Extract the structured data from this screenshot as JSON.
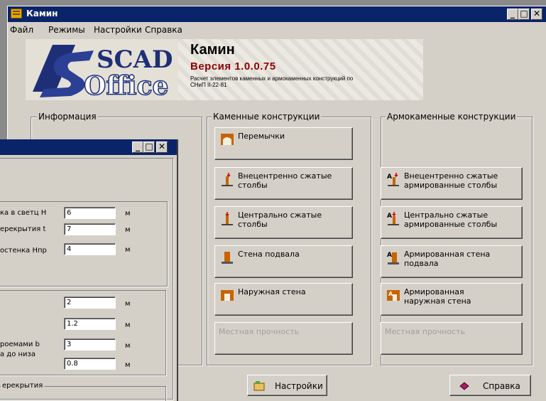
{
  "window": {
    "title": "Камин"
  },
  "menu": [
    "Файл",
    "Режимы",
    "Настройки",
    "Справка"
  ],
  "banner": {
    "logo_top": "SCAD",
    "logo_bottom": "Office",
    "title": "Камин",
    "version": "Версия 1.0.0.75",
    "description_line1": "Расчет элементов каменных и армокаменных конструкций по",
    "description_line2": "СНиП II-22-81"
  },
  "groups": {
    "info": "Информация",
    "stone": "Каменные конструкции",
    "reinforced": "Армокаменные конструкции"
  },
  "stone_buttons": [
    {
      "l1": "Перемычки",
      "l2": "",
      "icon": "lintel-icon"
    },
    {
      "l1": "Внецентренно сжатые",
      "l2": "столбы",
      "icon": "eccentric-column-icon"
    },
    {
      "l1": "Центрально сжатые",
      "l2": "столбы",
      "icon": "central-column-icon"
    },
    {
      "l1": "Стена подвала",
      "l2": "",
      "icon": "basement-wall-icon"
    },
    {
      "l1": "Наружная стена",
      "l2": "",
      "icon": "exterior-wall-icon"
    },
    {
      "l1": "Местная прочность",
      "l2": "",
      "icon": ""
    }
  ],
  "reinforced_buttons": [
    {
      "l1": "",
      "l2": "",
      "icon": ""
    },
    {
      "l1": "Внецентренно сжатые",
      "l2": "армированные столбы",
      "icon": "reinforced-eccentric-icon"
    },
    {
      "l1": "Центрально сжатые",
      "l2": "армированные столбы",
      "icon": "reinforced-central-icon"
    },
    {
      "l1": "Армированная стена",
      "l2": "подвала",
      "icon": "reinforced-basement-icon"
    },
    {
      "l1": "Армированная",
      "l2": "наружная стена",
      "icon": "reinforced-exterior-icon"
    },
    {
      "l1": "Местная прочность",
      "l2": "",
      "icon": ""
    }
  ],
  "bottom": {
    "settings": "Настройки",
    "help": "Справка"
  },
  "dialog": {
    "rows1": [
      {
        "label": "ка в светц H",
        "value": "6",
        "unit": "м"
      },
      {
        "label": "ерекрытия t",
        "value": "7",
        "unit": "м"
      },
      {
        "label": "остенка Hпр",
        "value": "4",
        "unit": "м"
      }
    ],
    "rows2": [
      {
        "label": "",
        "value": "2",
        "unit": "м"
      },
      {
        "label": "",
        "value": "1.2",
        "unit": "м"
      },
      {
        "label": "роемами b",
        "value": "3",
        "unit": "м"
      },
      {
        "label": "а до низа",
        "value": "0.8",
        "unit": "м"
      }
    ],
    "group3_label": "ерекрытия"
  }
}
